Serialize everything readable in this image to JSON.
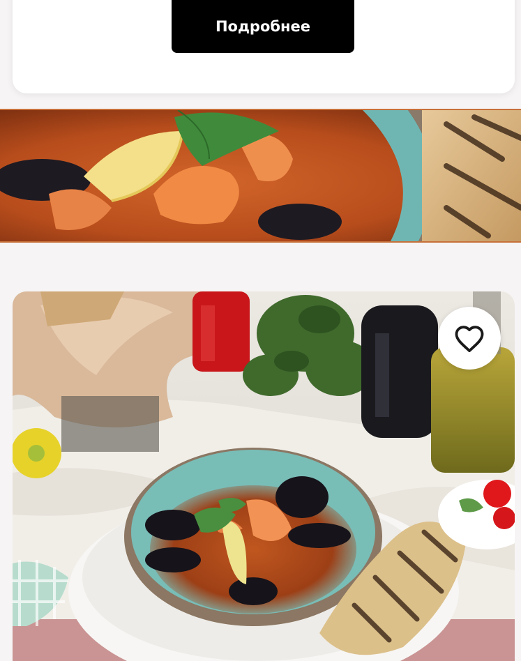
{
  "top_card": {
    "details_label": "Подробнее"
  },
  "banner": {
    "image": "seafood-soup-closeup-photo"
  },
  "product_card": {
    "image": "seafood-soup-table-photo",
    "favorite_icon": "heart-outline-icon"
  }
}
